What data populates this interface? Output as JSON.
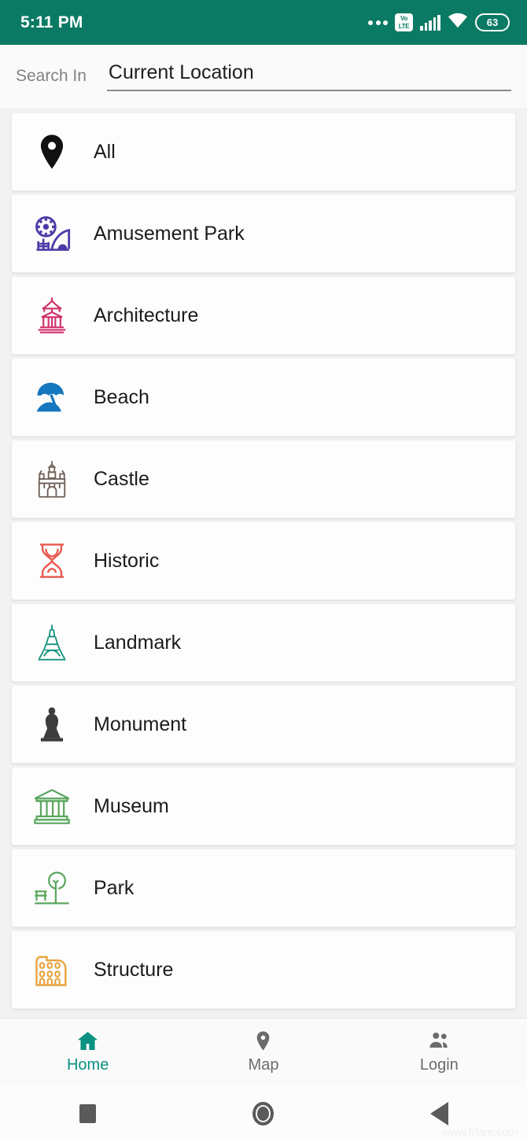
{
  "statusbar": {
    "time": "5:11 PM",
    "volte_top": "Vo",
    "volte_bottom": "LTE",
    "battery_percent": "63",
    "icons": [
      "more-dots-icon",
      "volte-icon",
      "signal-bars-icon",
      "wifi-icon",
      "battery-icon"
    ],
    "background_color": "#0b7a64"
  },
  "search": {
    "label": "Search In",
    "value": "Current Location",
    "placeholder": "Current Location"
  },
  "categories": [
    {
      "label": "All",
      "icon": "map-pin-icon",
      "color": "#111111"
    },
    {
      "label": "Amusement Park",
      "icon": "ferris-wheel-icon",
      "color": "#4b3ca7"
    },
    {
      "label": "Architecture",
      "icon": "pagoda-icon",
      "color": "#d1316c"
    },
    {
      "label": "Beach",
      "icon": "beach-umbrella-icon",
      "color": "#1577bd"
    },
    {
      "label": "Castle",
      "icon": "castle-icon",
      "color": "#6e6159"
    },
    {
      "label": "Historic",
      "icon": "hourglass-icon",
      "color": "#e8584e"
    },
    {
      "label": "Landmark",
      "icon": "eiffel-tower-icon",
      "color": "#13917e"
    },
    {
      "label": "Monument",
      "icon": "statue-icon",
      "color": "#3c3c3c"
    },
    {
      "label": "Museum",
      "icon": "museum-icon",
      "color": "#58a55c"
    },
    {
      "label": "Park",
      "icon": "park-tree-icon",
      "color": "#58a55c"
    },
    {
      "label": "Structure",
      "icon": "colosseum-icon",
      "color": "#e8a33d"
    }
  ],
  "bottom_nav": {
    "active_index": 0,
    "items": [
      {
        "label": "Home",
        "icon": "home-icon",
        "state": "active"
      },
      {
        "label": "Map",
        "icon": "map-pin-icon",
        "state": "inactive"
      },
      {
        "label": "Login",
        "icon": "people-icon",
        "state": "inactive"
      }
    ],
    "active_color": "#0b9182",
    "inactive_color": "#6b6b6b"
  },
  "android_nav": {
    "recents_label": "recents-square-icon",
    "home_label": "home-circle-icon",
    "back_label": "back-triangle-icon"
  },
  "watermark": "www.frfam.com"
}
